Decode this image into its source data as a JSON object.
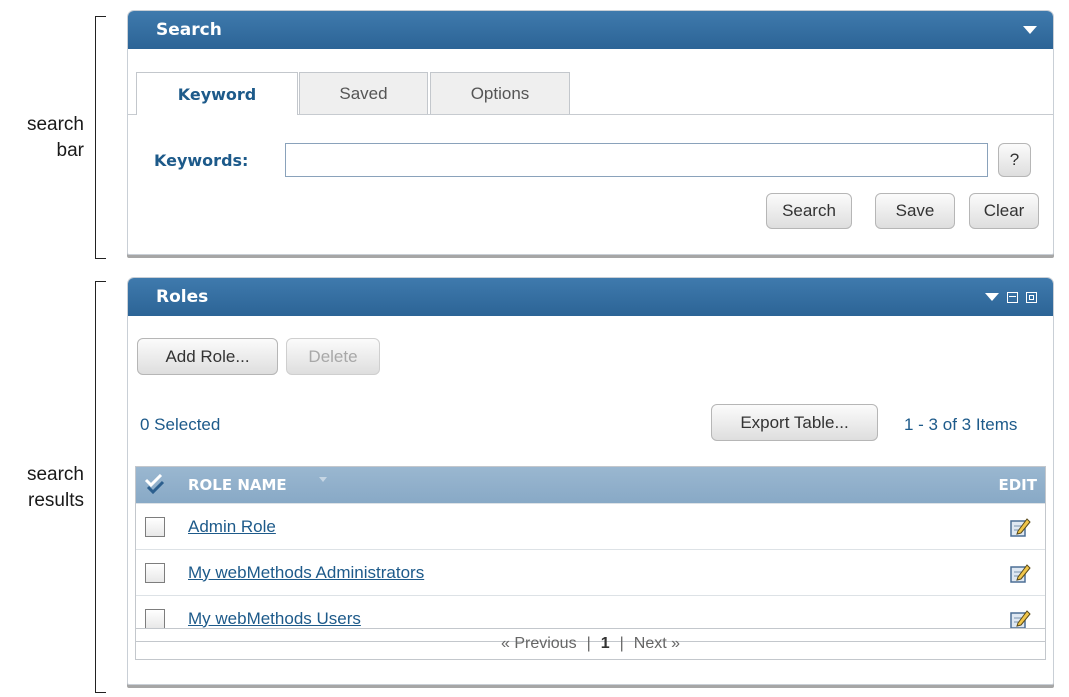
{
  "annotations": {
    "search_bar": [
      "search",
      "bar"
    ],
    "search_results": [
      "search",
      "results"
    ]
  },
  "search_panel": {
    "title": "Search",
    "tabs": [
      {
        "label": "Keyword",
        "active": true
      },
      {
        "label": "Saved",
        "active": false
      },
      {
        "label": "Options",
        "active": false
      }
    ],
    "keywords_label": "Keywords:",
    "keywords_value": "",
    "help_button": "?",
    "buttons": {
      "search": "Search",
      "save": "Save",
      "clear": "Clear"
    }
  },
  "roles_panel": {
    "title": "Roles",
    "add_role_button": "Add Role...",
    "delete_button": "Delete",
    "selected_text": "0 Selected",
    "export_button": "Export Table...",
    "items_count": "1 - 3 of 3 Items",
    "columns": {
      "role_name": "ROLE NAME",
      "edit": "EDIT"
    },
    "rows": [
      {
        "name": "Admin Role"
      },
      {
        "name": "My webMethods Administrators"
      },
      {
        "name": "My webMethods Users"
      }
    ],
    "pager": {
      "previous": "« Previous",
      "separator": "|",
      "current": "1",
      "next": "Next »"
    }
  },
  "colors": {
    "header_blue": "#2f6a9c",
    "link_blue": "#1d5a8a",
    "grid_header": "#8fafcb"
  }
}
